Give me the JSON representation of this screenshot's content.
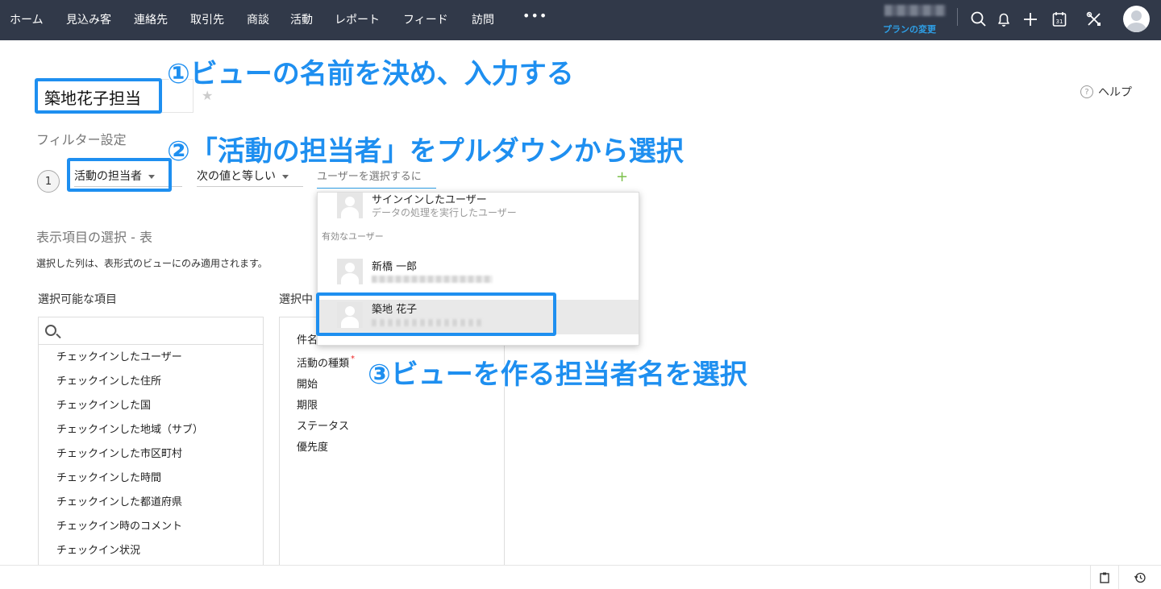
{
  "nav": {
    "items": [
      "ホーム",
      "見込み客",
      "連絡先",
      "取引先",
      "商談",
      "活動",
      "レポート",
      "フィード",
      "訪問"
    ],
    "more": "•••",
    "plan_change": "プランの変更",
    "icons": [
      "search-icon",
      "bell-icon",
      "plus-icon",
      "calendar-icon",
      "tools-icon",
      "avatar"
    ],
    "calendar_day": "31"
  },
  "annotations": {
    "step1": "①ビューの名前を決め、入力する",
    "step2": "②「活動の担当者」をプルダウンから選択",
    "step3": "③ビューを作る担当者名を選択"
  },
  "view": {
    "name": "築地花子担当",
    "help": "ヘルプ"
  },
  "filter": {
    "section_title": "フィルター設定",
    "number": "1",
    "field": "活動の担当者",
    "operator": "次の値と等しい",
    "value_placeholder": "ユーザーを選択するに"
  },
  "dropdown": {
    "signed_in": {
      "name": "サインインしたユーザー",
      "description": "データの処理を実行したユーザー"
    },
    "group_label": "有効なユーザー",
    "users": [
      {
        "name": "新橋 一郎"
      },
      {
        "name": "築地 花子",
        "selected": true
      }
    ]
  },
  "columns": {
    "section_title": "表示項目の選択 - 表",
    "note": "選択した列は、表形式のビューにのみ適用されます。",
    "available_title": "選択可能な項目",
    "selected_title": "選択中",
    "available": [
      "チェックインしたユーザー",
      "チェックインした住所",
      "チェックインした国",
      "チェックインした地域（サブ）",
      "チェックインした市区町村",
      "チェックインした時間",
      "チェックインした都道府県",
      "チェックイン時のコメント",
      "チェックイン状況"
    ],
    "selected": [
      {
        "label": "件名",
        "required": false
      },
      {
        "label": "活動の種類",
        "required": true
      },
      {
        "label": "開始",
        "required": false
      },
      {
        "label": "期限",
        "required": false
      },
      {
        "label": "ステータス",
        "required": false
      },
      {
        "label": "優先度",
        "required": false
      }
    ]
  },
  "colors": {
    "nav_bg": "#313949",
    "accent": "#1e8ff0",
    "link": "#2e9fe6",
    "add": "#7cc04b"
  }
}
